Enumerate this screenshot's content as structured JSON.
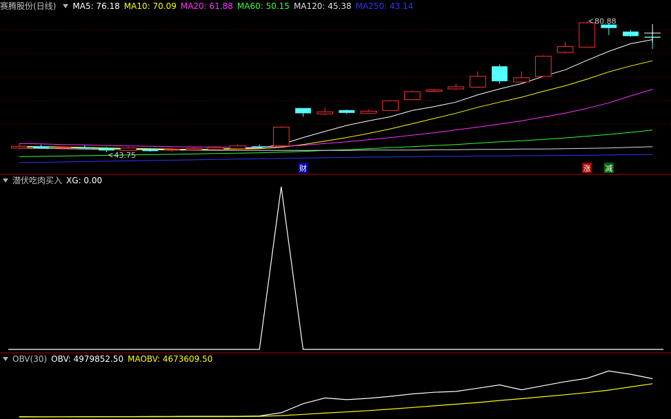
{
  "header": {
    "title": "赛腾股份(日线)",
    "ma": [
      {
        "label": "MA5: 76.18",
        "color": "#ffffff"
      },
      {
        "label": "MA10: 70.09",
        "color": "#ffff00"
      },
      {
        "label": "MA20: 61.88",
        "color": "#ff33ff"
      },
      {
        "label": "MA60: 50.15",
        "color": "#33ff33"
      },
      {
        "label": "MA120: 45.38",
        "color": "#dddddd"
      },
      {
        "label": "MA250: 43.14",
        "color": "#3333ff"
      }
    ]
  },
  "panel2": {
    "title": "潜伏吃肉买入",
    "xg": "XG: 0.00"
  },
  "panel3": {
    "title": "OBV(30)",
    "obv": "OBV: 4979852.50",
    "maobv": "MAOBV: 4673609.50"
  },
  "chart_data": [
    {
      "type": "candlestick",
      "title": "赛腾股份(日线)",
      "annotations": [
        {
          "text": "43.75",
          "kind": "low"
        },
        {
          "text": "80.88",
          "kind": "high"
        },
        {
          "text": "财",
          "bg": "#0000aa",
          "index": 13
        },
        {
          "text": "涨",
          "bg": "#aa0000",
          "index": 26
        },
        {
          "text": "减",
          "bg": "#006600",
          "index": 27
        }
      ],
      "ylim": [
        40,
        84
      ],
      "candles": [
        {
          "o": 45.0,
          "h": 46.2,
          "l": 44.5,
          "c": 45.5
        },
        {
          "o": 45.5,
          "h": 46.0,
          "l": 45.0,
          "c": 45.0
        },
        {
          "o": 45.0,
          "h": 45.6,
          "l": 44.6,
          "c": 45.2
        },
        {
          "o": 45.2,
          "h": 45.8,
          "l": 44.8,
          "c": 44.9
        },
        {
          "o": 44.9,
          "h": 45.3,
          "l": 43.75,
          "c": 44.3
        },
        {
          "o": 44.3,
          "h": 45.3,
          "l": 44.2,
          "c": 45.0
        },
        {
          "o": 44.7,
          "h": 45.0,
          "l": 43.9,
          "c": 44.1
        },
        {
          "o": 44.4,
          "h": 45.0,
          "l": 44.0,
          "c": 44.6
        },
        {
          "o": 44.5,
          "h": 45.3,
          "l": 44.2,
          "c": 44.9
        },
        {
          "o": 44.6,
          "h": 45.5,
          "l": 44.1,
          "c": 45.2
        },
        {
          "o": 44.8,
          "h": 46.0,
          "l": 44.6,
          "c": 45.6
        },
        {
          "o": 45.5,
          "h": 46.0,
          "l": 45.0,
          "c": 45.2
        },
        {
          "o": 45.6,
          "h": 51.2,
          "l": 45.4,
          "c": 51.0
        },
        {
          "o": 56.5,
          "h": 56.5,
          "l": 54.0,
          "c": 55.0
        },
        {
          "o": 54.8,
          "h": 56.6,
          "l": 54.5,
          "c": 55.4
        },
        {
          "o": 55.9,
          "h": 56.1,
          "l": 54.8,
          "c": 55.1
        },
        {
          "o": 55.0,
          "h": 56.0,
          "l": 55.0,
          "c": 55.6
        },
        {
          "o": 55.8,
          "h": 58.8,
          "l": 55.8,
          "c": 58.6
        },
        {
          "o": 58.9,
          "h": 61.5,
          "l": 58.8,
          "c": 61.2
        },
        {
          "o": 61.3,
          "h": 62.0,
          "l": 61.0,
          "c": 61.7
        },
        {
          "o": 62.0,
          "h": 63.5,
          "l": 61.8,
          "c": 62.6
        },
        {
          "o": 62.5,
          "h": 67.0,
          "l": 62.3,
          "c": 65.6
        },
        {
          "o": 68.5,
          "h": 69.0,
          "l": 63.5,
          "c": 64.2
        },
        {
          "o": 64.0,
          "h": 67.0,
          "l": 63.6,
          "c": 65.2
        },
        {
          "o": 65.6,
          "h": 71.6,
          "l": 65.4,
          "c": 71.4
        },
        {
          "o": 72.5,
          "h": 75.5,
          "l": 72.2,
          "c": 74.2
        },
        {
          "o": 74.0,
          "h": 81.5,
          "l": 73.9,
          "c": 81.0
        },
        {
          "o": 80.5,
          "h": 80.88,
          "l": 77.5,
          "c": 79.5
        },
        {
          "o": 78.5,
          "h": 79.0,
          "l": 77.0,
          "c": 77.2
        },
        {
          "o": 77.0,
          "h": 78.5,
          "l": 73.5,
          "c": 76.7
        }
      ],
      "series": [
        {
          "name": "MA5",
          "color": "#ffffff",
          "values": [
            45.4,
            45.3,
            45.2,
            45.0,
            44.9,
            44.8,
            44.7,
            44.6,
            44.5,
            44.7,
            44.9,
            45.0,
            46.0,
            48.0,
            49.8,
            51.5,
            52.8,
            54.0,
            55.8,
            56.9,
            58.2,
            60.3,
            62.0,
            63.5,
            65.6,
            67.5,
            70.2,
            72.8,
            75.0,
            76.18
          ]
        },
        {
          "name": "MA10",
          "color": "#ffff00",
          "values": [
            45.5,
            45.4,
            45.3,
            45.2,
            45.0,
            44.9,
            44.8,
            44.7,
            44.6,
            44.6,
            44.7,
            44.8,
            45.2,
            46.0,
            47.0,
            48.0,
            49.2,
            50.5,
            52.0,
            53.5,
            55.0,
            56.7,
            58.2,
            59.6,
            61.3,
            62.9,
            64.8,
            66.9,
            68.6,
            70.09
          ]
        },
        {
          "name": "MA20",
          "color": "#ff33ff",
          "values": [
            46.3,
            46.2,
            46.0,
            45.9,
            45.7,
            45.6,
            45.5,
            45.4,
            45.3,
            45.3,
            45.2,
            45.2,
            45.4,
            45.8,
            46.3,
            46.8,
            47.4,
            48.0,
            48.7,
            49.4,
            50.2,
            51.0,
            51.9,
            52.8,
            53.9,
            55.0,
            56.4,
            58.0,
            60.0,
            61.88
          ]
        },
        {
          "name": "MA60",
          "color": "#33ff33",
          "values": [
            42.5,
            42.6,
            42.7,
            42.8,
            42.9,
            43.0,
            43.1,
            43.2,
            43.3,
            43.4,
            43.5,
            43.6,
            43.8,
            44.0,
            44.3,
            44.5,
            44.8,
            45.1,
            45.4,
            45.7,
            46.0,
            46.4,
            46.8,
            47.1,
            47.5,
            47.9,
            48.4,
            48.9,
            49.5,
            50.15
          ]
        },
        {
          "name": "MA120",
          "color": "#dddddd",
          "values": [
            45.0,
            44.9,
            44.8,
            44.7,
            44.6,
            44.5,
            44.5,
            44.4,
            44.4,
            44.3,
            44.3,
            44.3,
            44.3,
            44.3,
            44.3,
            44.3,
            44.4,
            44.4,
            44.4,
            44.5,
            44.5,
            44.6,
            44.6,
            44.7,
            44.7,
            44.8,
            44.9,
            45.0,
            45.2,
            45.38
          ]
        },
        {
          "name": "MA250",
          "color": "#3333ff",
          "values": [
            40.8,
            40.9,
            41.0,
            41.1,
            41.2,
            41.3,
            41.4,
            41.5,
            41.6,
            41.7,
            41.8,
            41.9,
            42.0,
            42.1,
            42.2,
            42.3,
            42.4,
            42.4,
            42.5,
            42.6,
            42.6,
            42.7,
            42.7,
            42.8,
            42.8,
            42.9,
            42.9,
            43.0,
            43.1,
            43.14
          ]
        }
      ]
    },
    {
      "type": "line",
      "title": "潜伏吃肉买入",
      "ylim": [
        0,
        1
      ],
      "series": [
        {
          "name": "XG",
          "color": "#ffffff",
          "values": [
            0,
            0,
            0,
            0,
            0,
            0,
            0,
            0,
            0,
            0,
            0,
            0,
            1,
            0,
            0,
            0,
            0,
            0,
            0,
            0,
            0,
            0,
            0,
            0,
            0,
            0,
            0,
            0,
            0,
            0
          ]
        }
      ]
    },
    {
      "type": "line",
      "title": "OBV(30)",
      "ylim": [
        2600000,
        5800000
      ],
      "series": [
        {
          "name": "OBV",
          "color": "#ffffff",
          "values": [
            2660000,
            2650000,
            2650000,
            2660000,
            2660000,
            2660000,
            2670000,
            2670000,
            2680000,
            2680000,
            2680000,
            2700000,
            2900000,
            3450000,
            3800000,
            3700000,
            3780000,
            3900000,
            4050000,
            4150000,
            4200000,
            4400000,
            4600000,
            4300000,
            4550000,
            4800000,
            5000000,
            5450000,
            5250000,
            4979852.5
          ]
        },
        {
          "name": "MAOBV",
          "color": "#ffff00",
          "values": [
            2640000,
            2640000,
            2645000,
            2645000,
            2650000,
            2650000,
            2652000,
            2655000,
            2658000,
            2660000,
            2665000,
            2680000,
            2720000,
            2800000,
            2880000,
            2950000,
            3030000,
            3120000,
            3220000,
            3320000,
            3420000,
            3520000,
            3650000,
            3760000,
            3880000,
            4000000,
            4130000,
            4280000,
            4480000,
            4673609.5
          ]
        }
      ]
    }
  ]
}
